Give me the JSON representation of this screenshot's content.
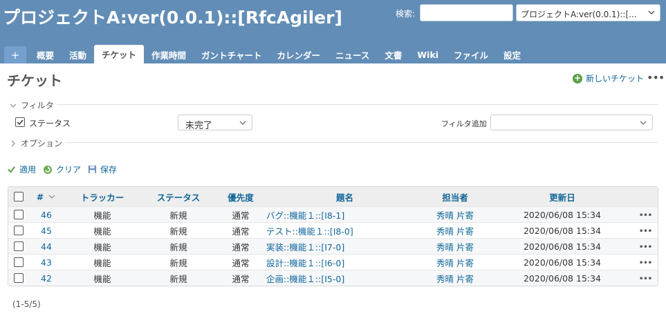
{
  "header": {
    "project_title": "プロジェクトA:ver(0.0.1)::[RfcAgiler]",
    "search_label": "検索:",
    "search_value": "",
    "project_jump_value": "プロジェクトA:ver(0.0.1)::[..."
  },
  "menu": {
    "plus_label": "+",
    "tabs": [
      {
        "label": "概要"
      },
      {
        "label": "活動"
      },
      {
        "label": "チケット"
      },
      {
        "label": "作業時間"
      },
      {
        "label": "ガントチャート"
      },
      {
        "label": "カレンダー"
      },
      {
        "label": "ニュース"
      },
      {
        "label": "文書"
      },
      {
        "label": "Wiki"
      },
      {
        "label": "ファイル"
      },
      {
        "label": "設定"
      }
    ],
    "selected": "チケット"
  },
  "page": {
    "heading": "チケット",
    "new_issue_label": "新しいチケット",
    "more_label": "•••"
  },
  "filters": {
    "legend": "フィルタ",
    "status_checked": true,
    "status_label": "ステータス",
    "status_operator": "未完了",
    "add_filter_label": "フィルタ追加",
    "add_filter_value": ""
  },
  "options": {
    "legend": "オプション"
  },
  "actions": {
    "apply": "適用",
    "clear": "クリア",
    "save": "保存"
  },
  "table": {
    "columns": {
      "id": "#",
      "tracker": "トラッカー",
      "status": "ステータス",
      "priority": "優先度",
      "subject": "題名",
      "assignee": "担当者",
      "updated": "更新日"
    },
    "rows": [
      {
        "id": "46",
        "tracker": "機能",
        "status": "新規",
        "priority": "通常",
        "subject": "バグ::機能１::[I8-1]",
        "assignee": "秀晴 片寄",
        "updated": "2020/06/08 15:34"
      },
      {
        "id": "45",
        "tracker": "機能",
        "status": "新規",
        "priority": "通常",
        "subject": "テスト::機能１::[I8-0]",
        "assignee": "秀晴 片寄",
        "updated": "2020/06/08 15:34"
      },
      {
        "id": "44",
        "tracker": "機能",
        "status": "新規",
        "priority": "通常",
        "subject": "実装::機能１::[I7-0]",
        "assignee": "秀晴 片寄",
        "updated": "2020/06/08 15:34"
      },
      {
        "id": "43",
        "tracker": "機能",
        "status": "新規",
        "priority": "通常",
        "subject": "設計::機能１::[I6-0]",
        "assignee": "秀晴 片寄",
        "updated": "2020/06/08 15:34"
      },
      {
        "id": "42",
        "tracker": "機能",
        "status": "新規",
        "priority": "通常",
        "subject": "企画::機能１::[I5-0]",
        "assignee": "秀晴 片寄",
        "updated": "2020/06/08 15:34"
      }
    ],
    "row_menu": "•••"
  },
  "pagination": "(1-5/5)"
}
